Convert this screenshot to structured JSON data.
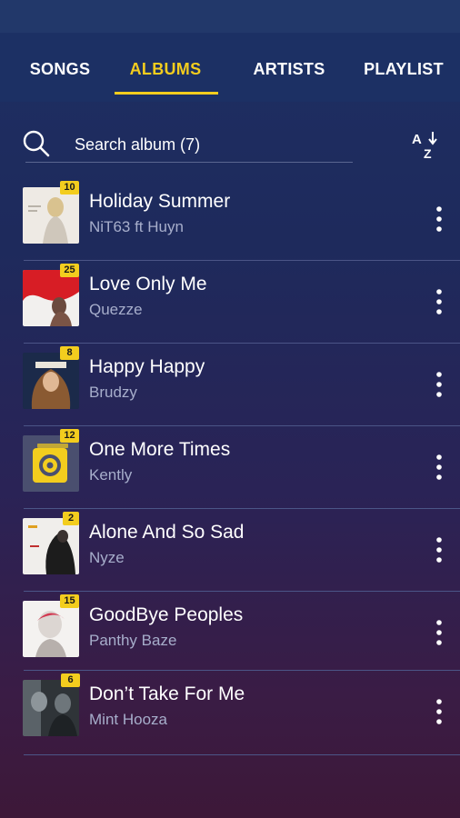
{
  "tabs": [
    {
      "label": "SONGS",
      "active": false
    },
    {
      "label": "ALBUMS",
      "active": true
    },
    {
      "label": "ARTISTS",
      "active": false
    },
    {
      "label": "PLAYLIST",
      "active": false
    }
  ],
  "search": {
    "placeholder": "Search album (7)",
    "icon": "search-icon",
    "sort_icon": "sort-az-icon"
  },
  "colors": {
    "accent": "#f3cd1e",
    "secondary_text": "#a7aecb"
  },
  "albums": [
    {
      "title": "Holiday Summer",
      "artist": "NiT63 ft Huyn",
      "count": "10"
    },
    {
      "title": "Love Only Me",
      "artist": "Quezze",
      "count": "25"
    },
    {
      "title": "Happy Happy",
      "artist": "Brudzy",
      "count": "8"
    },
    {
      "title": "One More Times",
      "artist": "Kently",
      "count": "12"
    },
    {
      "title": "Alone And So Sad",
      "artist": "Nyze",
      "count": "2"
    },
    {
      "title": "GoodBye Peoples",
      "artist": "Panthy Baze",
      "count": "15"
    },
    {
      "title": "Don’t Take For Me",
      "artist": "Mint Hooza",
      "count": "6"
    }
  ]
}
